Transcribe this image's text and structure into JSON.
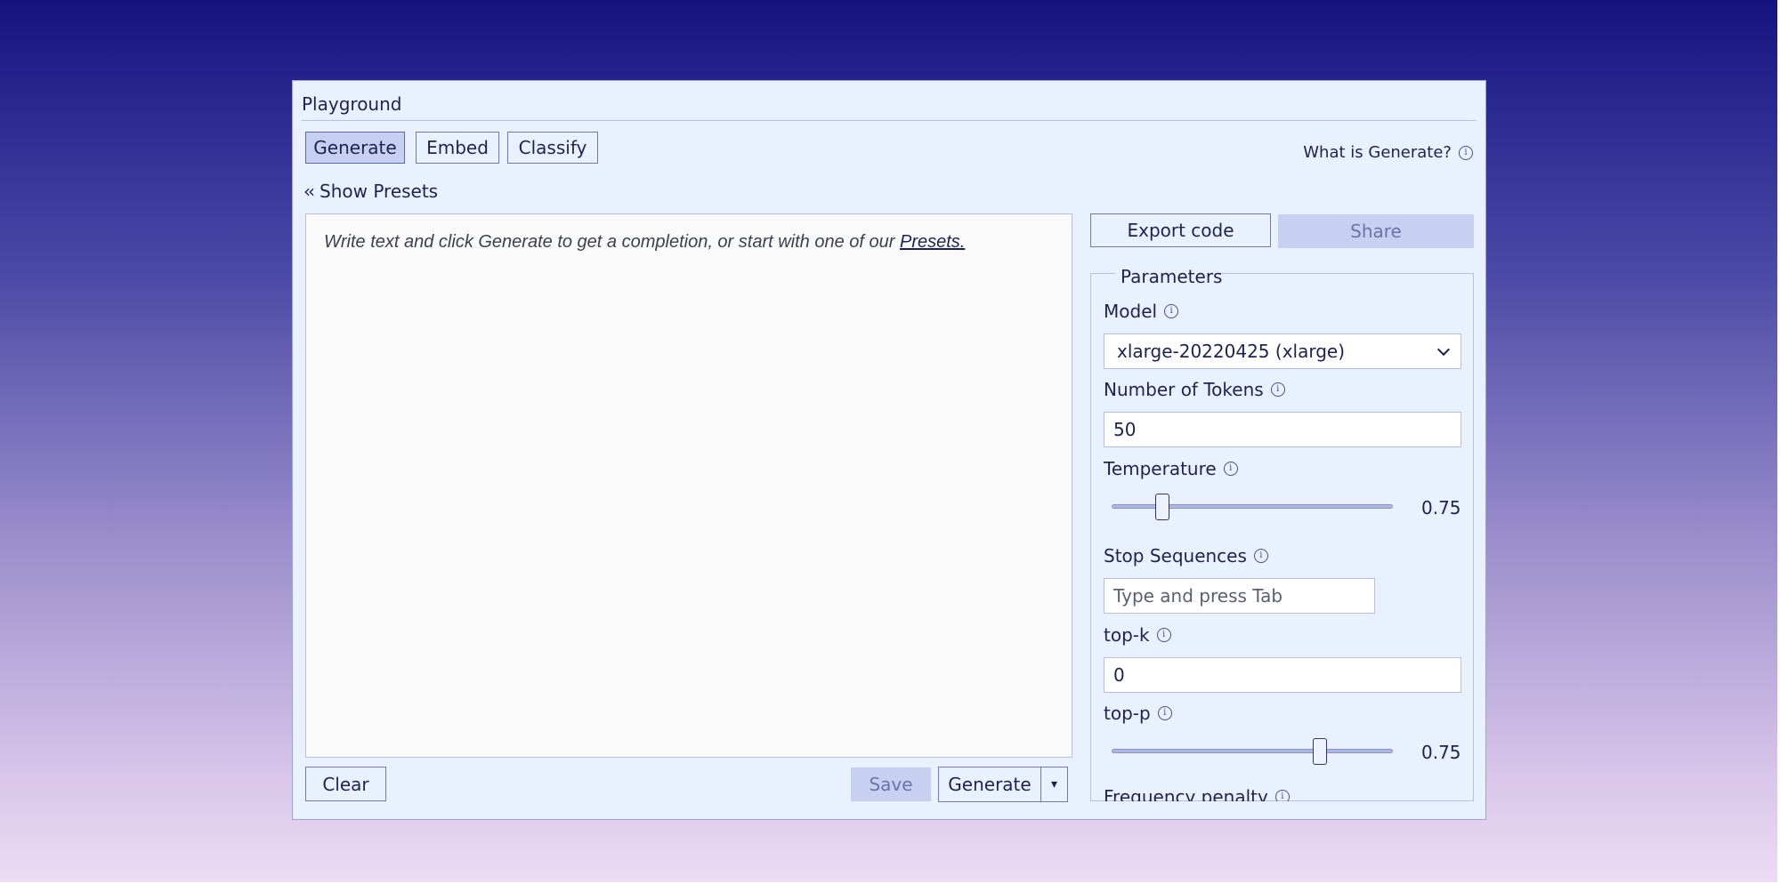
{
  "window": {
    "title": "Playground"
  },
  "tabs": [
    {
      "label": "Generate",
      "active": true
    },
    {
      "label": "Embed",
      "active": false
    },
    {
      "label": "Classify",
      "active": false
    }
  ],
  "help_link": "What is Generate?",
  "presets_toggle": "Show Presets",
  "editor": {
    "placeholder_text": "Write text and click Generate to get a completion, or start with one of our ",
    "presets_link": "Presets."
  },
  "actions": {
    "clear": "Clear",
    "save": "Save",
    "generate": "Generate",
    "more": "▾",
    "export_code": "Export code",
    "share": "Share"
  },
  "parameters": {
    "legend": "Parameters",
    "model": {
      "label": "Model",
      "value": "xlarge-20220425 (xlarge)"
    },
    "num_tokens": {
      "label": "Number of Tokens",
      "value": "50"
    },
    "temperature": {
      "label": "Temperature",
      "value": "0.75",
      "fraction": 0.18
    },
    "stop_sequences": {
      "label": "Stop Sequences",
      "placeholder": "Type and press Tab"
    },
    "top_k": {
      "label": "top-k",
      "value": "0"
    },
    "top_p": {
      "label": "top-p",
      "value": "0.75",
      "fraction": 0.74
    },
    "frequency_penalty": {
      "label": "Frequency penalty"
    }
  },
  "colors": {
    "accent": "#c7d0f0",
    "border": "#6e79b5",
    "text": "#1d2350"
  }
}
